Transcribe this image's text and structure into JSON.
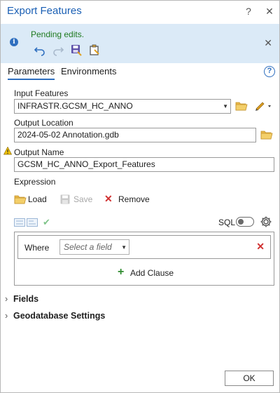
{
  "window": {
    "title": "Export Features",
    "help_glyph": "?",
    "close_glyph": "✕"
  },
  "banner": {
    "message": "Pending edits.",
    "close_glyph": "✕",
    "icons": [
      "info-icon",
      "undo-icon",
      "redo-icon",
      "save-edits-icon",
      "discard-edits-icon"
    ]
  },
  "tabs": [
    {
      "label": "Parameters",
      "active": true
    },
    {
      "label": "Environments",
      "active": false
    }
  ],
  "help_glyph": "?",
  "input_features": {
    "label": "Input Features",
    "value": "INFRASTR.GCSM_HC_ANNO"
  },
  "output_location": {
    "label": "Output Location",
    "value": "2024-05-02 Annotation.gdb"
  },
  "output_name": {
    "label": "Output Name",
    "value": "GCSM_HC_ANNO_Export_Features"
  },
  "expression": {
    "label": "Expression",
    "load_label": "Load",
    "save_label": "Save",
    "remove_label": "Remove",
    "sql_label": "SQL",
    "sql_toggle_on": false,
    "where_label": "Where",
    "field_placeholder": "Select a field",
    "add_clause_label": "Add Clause"
  },
  "sections": [
    {
      "label": "Fields"
    },
    {
      "label": "Geodatabase Settings"
    }
  ],
  "ok_label": "OK",
  "colors": {
    "accent": "#2f6fbf",
    "banner_bg": "#dbeaf7",
    "pending_text": "#1f7a1f",
    "remove_red": "#d03030",
    "add_green": "#2e8b2e"
  }
}
